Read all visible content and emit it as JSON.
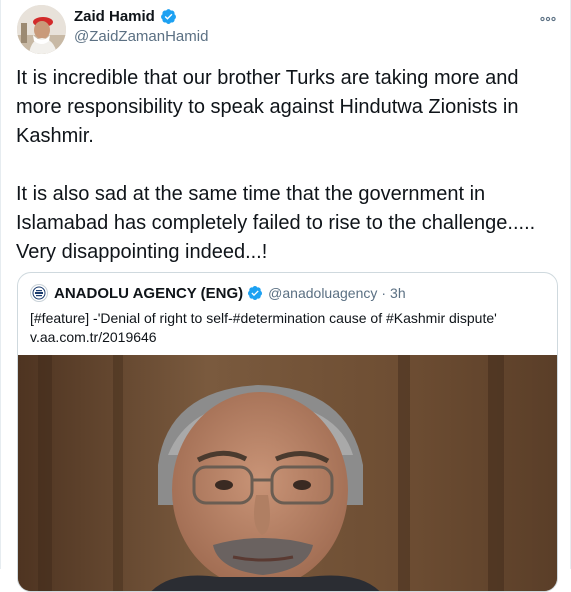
{
  "tweet": {
    "author_name": "Zaid Hamid",
    "author_handle": "@ZaidZamanHamid",
    "more_icon": "more-icon",
    "text": "It is incredible that our brother Turks are taking more and more responsibility to speak against Hindutwa Zionists in Kashmir.\n\nIt is also sad at the same time that the government in Islamabad has completely failed to rise to the challenge..... Very disappointing indeed...!"
  },
  "quote": {
    "name": "ANADOLU AGENCY (ENG)",
    "handle": "@anadoluagency",
    "separator": "·",
    "time": "3h",
    "text_line1": "[#feature] -'Denial of right to self-#determination cause of #Kashmir dispute'",
    "text_line2": "v.aa.com.tr/2019646"
  },
  "colors": {
    "verified_blue": "#1da1f2",
    "secondary_text": "#5b7083"
  }
}
